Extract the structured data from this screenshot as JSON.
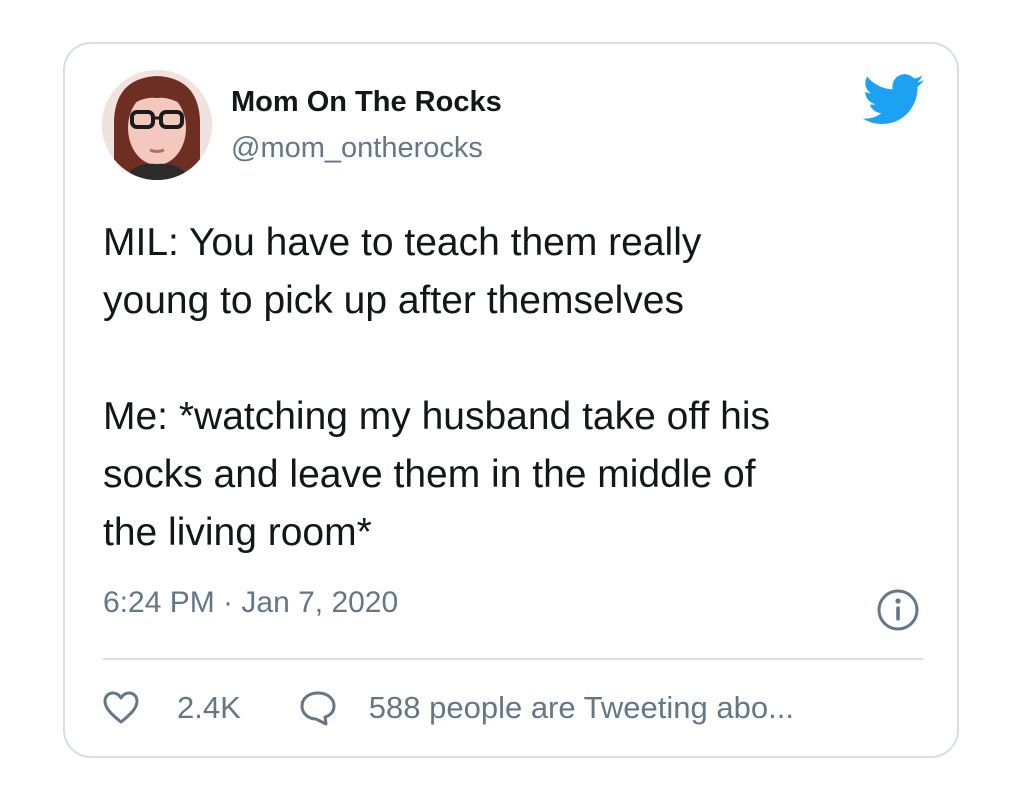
{
  "tweet": {
    "display_name": "Mom On The Rocks",
    "handle": "@mom_ontherocks",
    "text": "MIL: You have to teach them really\nyoung to pick up after themselves\n\nMe: *watching my husband take off his\nsocks and leave them in the middle of\nthe living room*",
    "timestamp": "6:24 PM · Jan 7, 2020",
    "likes": "2.4K",
    "discussion": "588 people are Tweeting abo..."
  },
  "icons": {
    "logo": "twitter-bird-icon",
    "info": "info-icon",
    "like": "heart-icon",
    "reply": "speech-bubble-icon"
  },
  "colors": {
    "text": "#14171a",
    "secondary": "#657786",
    "twitter_blue": "#1da1f2",
    "border": "#d9dee3"
  }
}
